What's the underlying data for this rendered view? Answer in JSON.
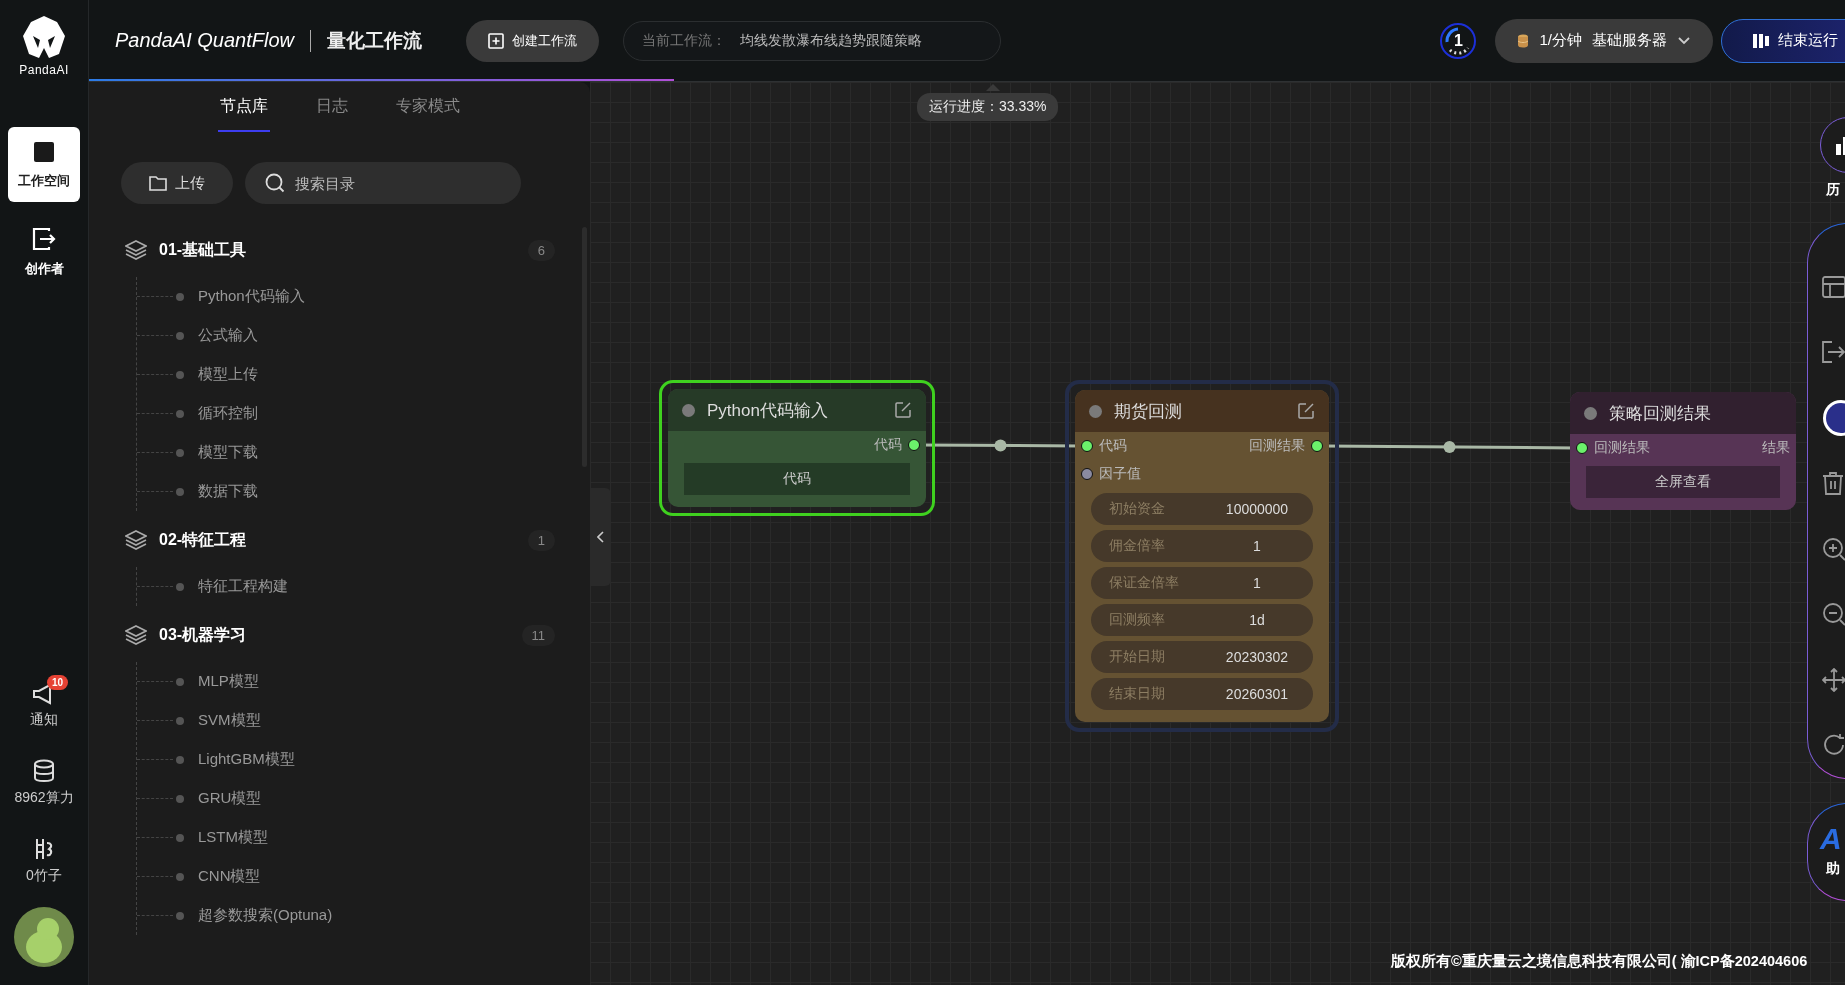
{
  "rail": {
    "logo_text": "PandaAI",
    "items": [
      {
        "label": "工作空间",
        "kind": "workspace",
        "selected": true
      },
      {
        "label": "创作者",
        "kind": "creator",
        "selected": false
      }
    ],
    "tools": [
      {
        "label": "通知",
        "kind": "notice",
        "badge": "10"
      },
      {
        "label": "8962算力",
        "kind": "compute"
      },
      {
        "label": "0竹子",
        "kind": "bamboo"
      }
    ]
  },
  "header": {
    "brand": "PandaAI QuantFlow",
    "title": "量化工作流",
    "create_button": "创建工作流",
    "workflow_label": "当前工作流：",
    "workflow_name": "均线发散瀑布线趋势跟随策略",
    "queue_count": "1",
    "rate": "1/分钟",
    "server": "基础服务器",
    "stop_button": "结束运行"
  },
  "progress": {
    "level": 0.3333,
    "label": "运行进度：33.33%"
  },
  "panel": {
    "tabs": [
      {
        "label": "节点库",
        "selected": true
      },
      {
        "label": "日志",
        "selected": false
      },
      {
        "label": "专家模式",
        "selected": false
      }
    ],
    "upload_button": "上传",
    "search": {
      "placeholder": "搜索目录"
    },
    "groups": [
      {
        "title": "01-基础工具",
        "count": "6",
        "items": [
          "Python代码输入",
          "公式输入",
          "模型上传",
          "循环控制",
          "模型下载",
          "数据下载"
        ]
      },
      {
        "title": "02-特征工程",
        "count": "1",
        "items": [
          "特征工程构建"
        ]
      },
      {
        "title": "03-机器学习",
        "count": "11",
        "items": [
          "MLP模型",
          "SVM模型",
          "LightGBM模型",
          "GRU模型",
          "LSTM模型",
          "CNN模型",
          "超参数搜索(Optuna)"
        ]
      }
    ]
  },
  "nodes": [
    {
      "kind": "code",
      "title": "Python代码输入",
      "selected": true,
      "running": false,
      "outputs": [
        "代码"
      ],
      "button": "代码"
    },
    {
      "kind": "backtest",
      "title": "期货回测",
      "selected": false,
      "running": true,
      "inputs": [
        {
          "label": "代码",
          "connected": true
        },
        {
          "label": "因子值",
          "connected": false
        }
      ],
      "outputs": [
        "回测结果"
      ],
      "params": [
        {
          "label": "初始资金",
          "value": "10000000"
        },
        {
          "label": "佣金倍率",
          "value": "1"
        },
        {
          "label": "保证金倍率",
          "value": "1"
        },
        {
          "label": "回测频率",
          "value": "1d"
        },
        {
          "label": "开始日期",
          "value": "20230302"
        },
        {
          "label": "结束日期",
          "value": "20260301"
        }
      ]
    },
    {
      "kind": "result",
      "title": "策略回测结果",
      "selected": false,
      "running": false,
      "inputs": [
        {
          "label": "回测结果",
          "connected": true
        }
      ],
      "outputs": [
        "结果"
      ],
      "button": "全屏查看"
    }
  ],
  "toolbar": {
    "history_label": "历",
    "assistant_logo": "A",
    "assistant_label": "助"
  },
  "footer": "版权所有©重庆量云之境信息科技有限公司( 渝ICP备202404606"
}
